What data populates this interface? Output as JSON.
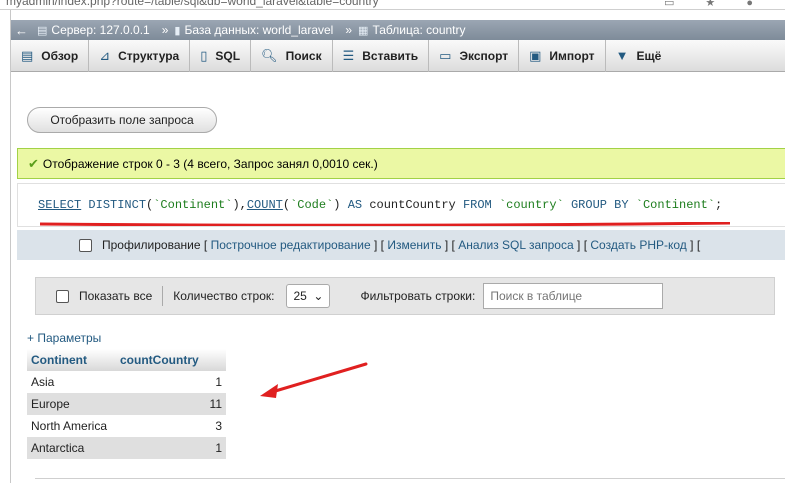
{
  "browser": {
    "url": "myadmin/index.php?route=/table/sql&db=world_laravel&table=country"
  },
  "breadcrumb": {
    "server_label": "Сервер: 127.0.0.1",
    "database_label": "База данных: world_laravel",
    "table_label": "Таблица: country",
    "separator": "»"
  },
  "tabs": [
    {
      "label": "Обзор",
      "icon": "browse-icon"
    },
    {
      "label": "Структура",
      "icon": "structure-icon"
    },
    {
      "label": "SQL",
      "icon": "sql-icon"
    },
    {
      "label": "Поиск",
      "icon": "search-icon"
    },
    {
      "label": "Вставить",
      "icon": "insert-icon"
    },
    {
      "label": "Экспорт",
      "icon": "export-icon"
    },
    {
      "label": "Импорт",
      "icon": "import-icon"
    },
    {
      "label": "Ещё",
      "icon": "more-icon"
    }
  ],
  "show_query_button": "Отобразить поле запроса",
  "success_message": "Отображение строк 0 - 3 (4 всего, Запрос занял 0,0010 сек.)",
  "sql": {
    "select": "SELECT",
    "distinct": "DISTINCT",
    "paren_open": "(",
    "paren_close": ")",
    "comma": ",",
    "col_continent": "`Continent`",
    "count_fn": "COUNT",
    "col_code": "`Code`",
    "as": "AS",
    "alias": "countCountry",
    "from": "FROM",
    "table": "`country`",
    "group_by": "GROUP BY",
    "group_col": "`Continent`",
    "semicolon": ";"
  },
  "profile_bar": {
    "profiling_label": "Профилирование",
    "open_bracket": "[",
    "close_bracket": "]",
    "links": [
      "Построчное редактирование",
      "Изменить",
      "Анализ SQL запроса",
      "Создать PHP-код"
    ]
  },
  "nav_bar": {
    "show_all_label": "Показать все",
    "rows_count_label": "Количество строк:",
    "rows_count_value": "25",
    "filter_label": "Фильтровать строки:",
    "search_placeholder": "Поиск в таблице"
  },
  "params_link": "+ Параметры",
  "result_table": {
    "headers": [
      "Continent",
      "countCountry"
    ],
    "rows": [
      [
        "Asia",
        "1"
      ],
      [
        "Europe",
        "11"
      ],
      [
        "North America",
        "3"
      ],
      [
        "Antarctica",
        "1"
      ]
    ]
  },
  "colors": {
    "accent_link": "#235a81",
    "success_bg": "#ebf8a4",
    "annotation_red": "#e02020"
  }
}
